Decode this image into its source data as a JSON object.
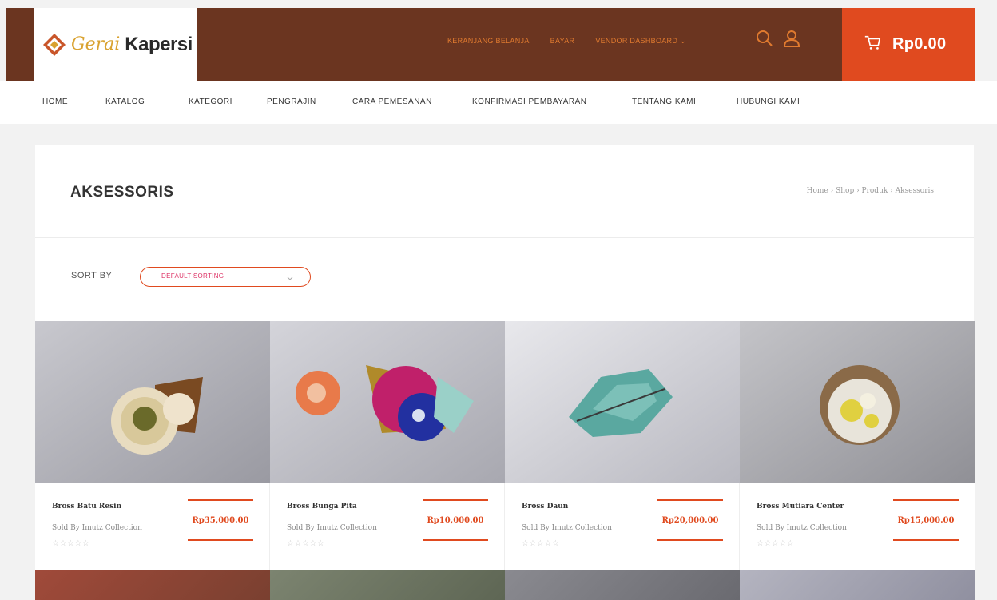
{
  "brand": {
    "script": "Gerai",
    "bold": "Kapersi"
  },
  "header_links": [
    "KERANJANG BELANJA",
    "BAYAR",
    "VENDOR DASHBOARD"
  ],
  "cart": {
    "total": "Rp0.00"
  },
  "nav": [
    "HOME",
    "KATALOG",
    "KATEGORI",
    "PENGRAJIN",
    "CARA PEMESANAN",
    "KONFIRMASI PEMBAYARAN",
    "TENTANG KAMI",
    "HUBUNGI KAMI"
  ],
  "page": {
    "title": "AKSESSORIS",
    "breadcrumb": "Home › Shop › Produk › Aksessoris"
  },
  "sort": {
    "label": "SORT BY",
    "value": "DEFAULT SORTING"
  },
  "products": [
    {
      "name": "Bross Batu Resin",
      "seller": "Sold By Imutz Collection",
      "price": "Rp35,000.00",
      "stars": "☆☆☆☆☆"
    },
    {
      "name": "Bross Bunga Pita",
      "seller": "Sold By Imutz Collection",
      "price": "Rp10,000.00",
      "stars": "☆☆☆☆☆"
    },
    {
      "name": "Bross Daun",
      "seller": "Sold By Imutz Collection",
      "price": "Rp20,000.00",
      "stars": "☆☆☆☆☆"
    },
    {
      "name": "Bross Mutiara Center",
      "seller": "Sold By Imutz Collection",
      "price": "Rp15,000.00",
      "stars": "☆☆☆☆☆"
    }
  ],
  "colors": {
    "brown": "#6b3520",
    "accent": "#e04a1f",
    "gold": "#d9a230"
  },
  "icons": [
    "search-icon",
    "user-icon",
    "cart-icon",
    "chevron-down-icon"
  ]
}
